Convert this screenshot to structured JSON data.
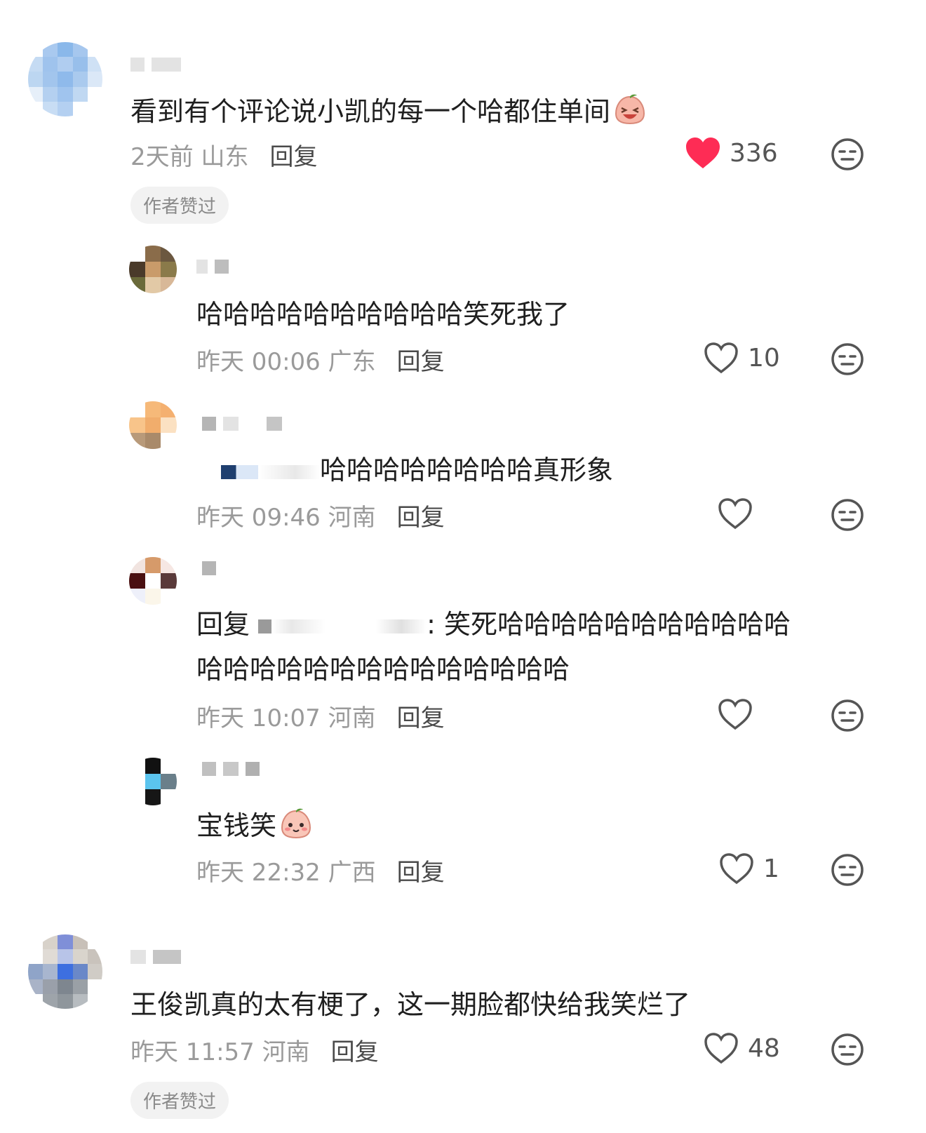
{
  "comments": [
    {
      "text": "看到有个评论说小凯的每一个哈都住单间",
      "emoji": "laughing-peach-emoji",
      "time": "2天前",
      "location": "山东",
      "reply_label": "回复",
      "likes": "336",
      "liked": true,
      "badge": "作者赞过"
    },
    {
      "text": "哈哈哈哈哈哈哈哈哈哈笑死我了",
      "time": "昨天 00:06",
      "location": "广东",
      "reply_label": "回复",
      "likes": "10"
    },
    {
      "text": "哈哈哈哈哈哈哈哈真形象",
      "time": "昨天 09:46",
      "location": "河南",
      "reply_label": "回复",
      "likes": ""
    },
    {
      "reply_prefix": "回复",
      "text_line1": ": 笑死哈哈哈哈哈哈哈哈哈哈哈",
      "text_line2": "哈哈哈哈哈哈哈哈哈哈哈哈哈哈",
      "time": "昨天 10:07",
      "location": "河南",
      "reply_label": "回复",
      "likes": ""
    },
    {
      "text": "宝钱笑",
      "emoji": "smiling-peach-emoji",
      "time": "昨天 22:32",
      "location": "广西",
      "reply_label": "回复",
      "likes": "1"
    },
    {
      "text": "王俊凯真的太有梗了，这一期脸都快给我笑烂了",
      "time": "昨天 11:57",
      "location": "河南",
      "reply_label": "回复",
      "likes": "48",
      "badge": "作者赞过"
    }
  ],
  "colors": {
    "liked_heart": "#fe2c55",
    "meta": "#9a9a9a",
    "text": "#1f1f1f"
  }
}
